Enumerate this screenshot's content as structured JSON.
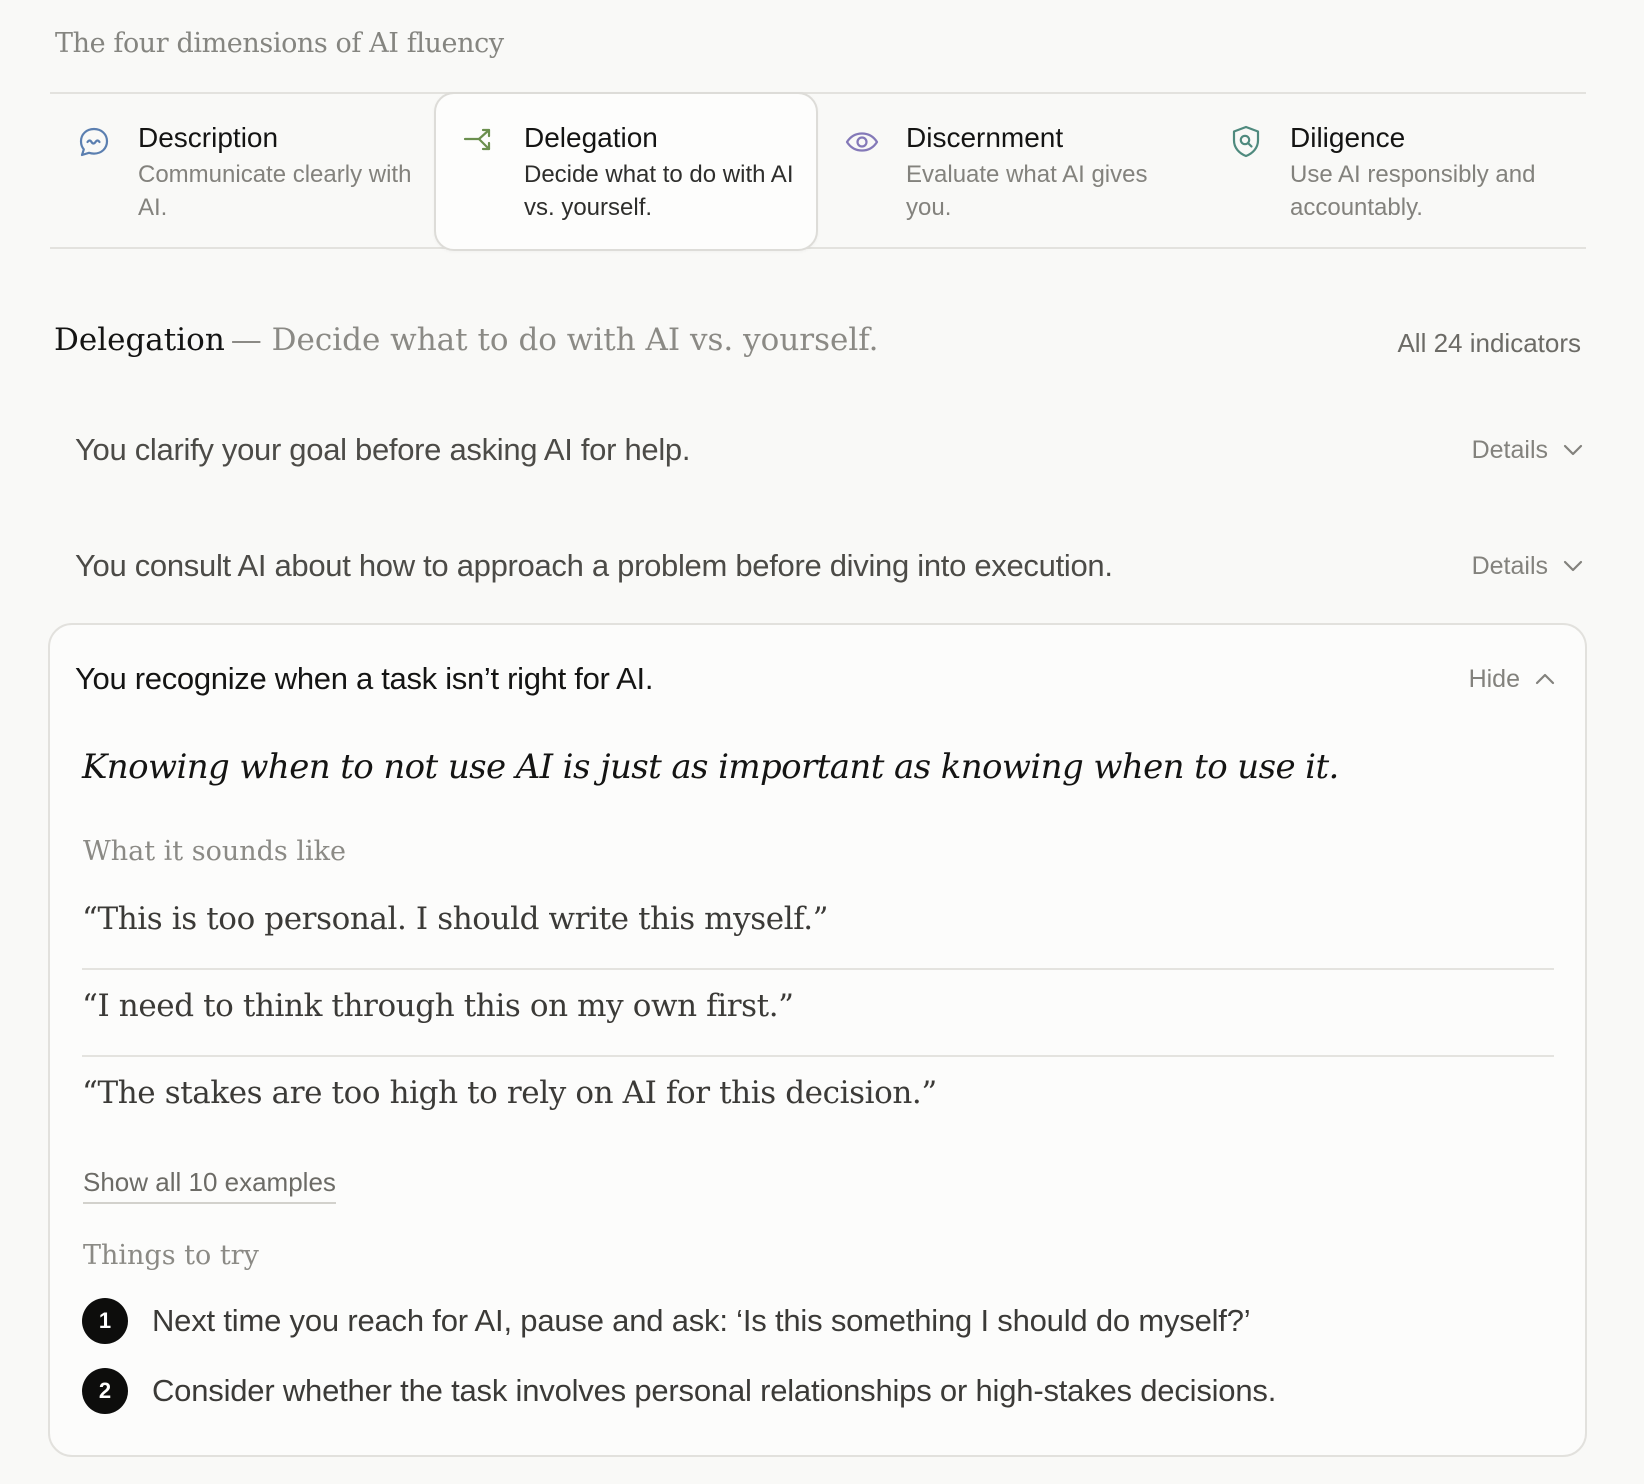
{
  "page_title": "The four dimensions of AI fluency",
  "dimensions": [
    {
      "title": "Description",
      "desc": "Communicate clearly with AI.",
      "icon": "chat-bubble-icon",
      "color": "#5b7fb0",
      "active": false
    },
    {
      "title": "Delegation",
      "desc": "Decide what to do with AI vs. yourself.",
      "icon": "split-arrow-icon",
      "color": "#6b8f4e",
      "active": true
    },
    {
      "title": "Discernment",
      "desc": "Evaluate what AI gives you.",
      "icon": "eye-icon",
      "color": "#8479b8",
      "active": false
    },
    {
      "title": "Diligence",
      "desc": "Use AI responsibly and accountably.",
      "icon": "shield-search-icon",
      "color": "#4f8a7e",
      "active": false
    }
  ],
  "section": {
    "name": "Delegation",
    "separator": "— Decide what to do with AI vs. yourself.",
    "all_indicators": "All 24 indicators"
  },
  "indicators": [
    {
      "text": "You clarify your goal before asking AI for help.",
      "toggle": "Details"
    },
    {
      "text": "You consult AI about how to approach a problem before diving into execution.",
      "toggle": "Details"
    }
  ],
  "expanded": {
    "title": "You recognize when a task isn’t right for AI.",
    "toggle": "Hide",
    "quote": "Knowing when to not use AI is just as important as knowing when to use it.",
    "sounds_like_label": "What it sounds like",
    "examples": [
      "“This is too personal. I should write this myself.”",
      "“I need to think through this on my own first.”",
      "“The stakes are too high to rely on AI for this decision.”"
    ],
    "show_all": "Show all 10 examples",
    "things_label": "Things to try",
    "tries": [
      {
        "num": "1",
        "text": "Next time you reach for AI, pause and ask: ‘Is this something I should do myself?’"
      },
      {
        "num": "2",
        "text": "Consider whether the task involves personal relationships or high-stakes decisions."
      }
    ]
  }
}
